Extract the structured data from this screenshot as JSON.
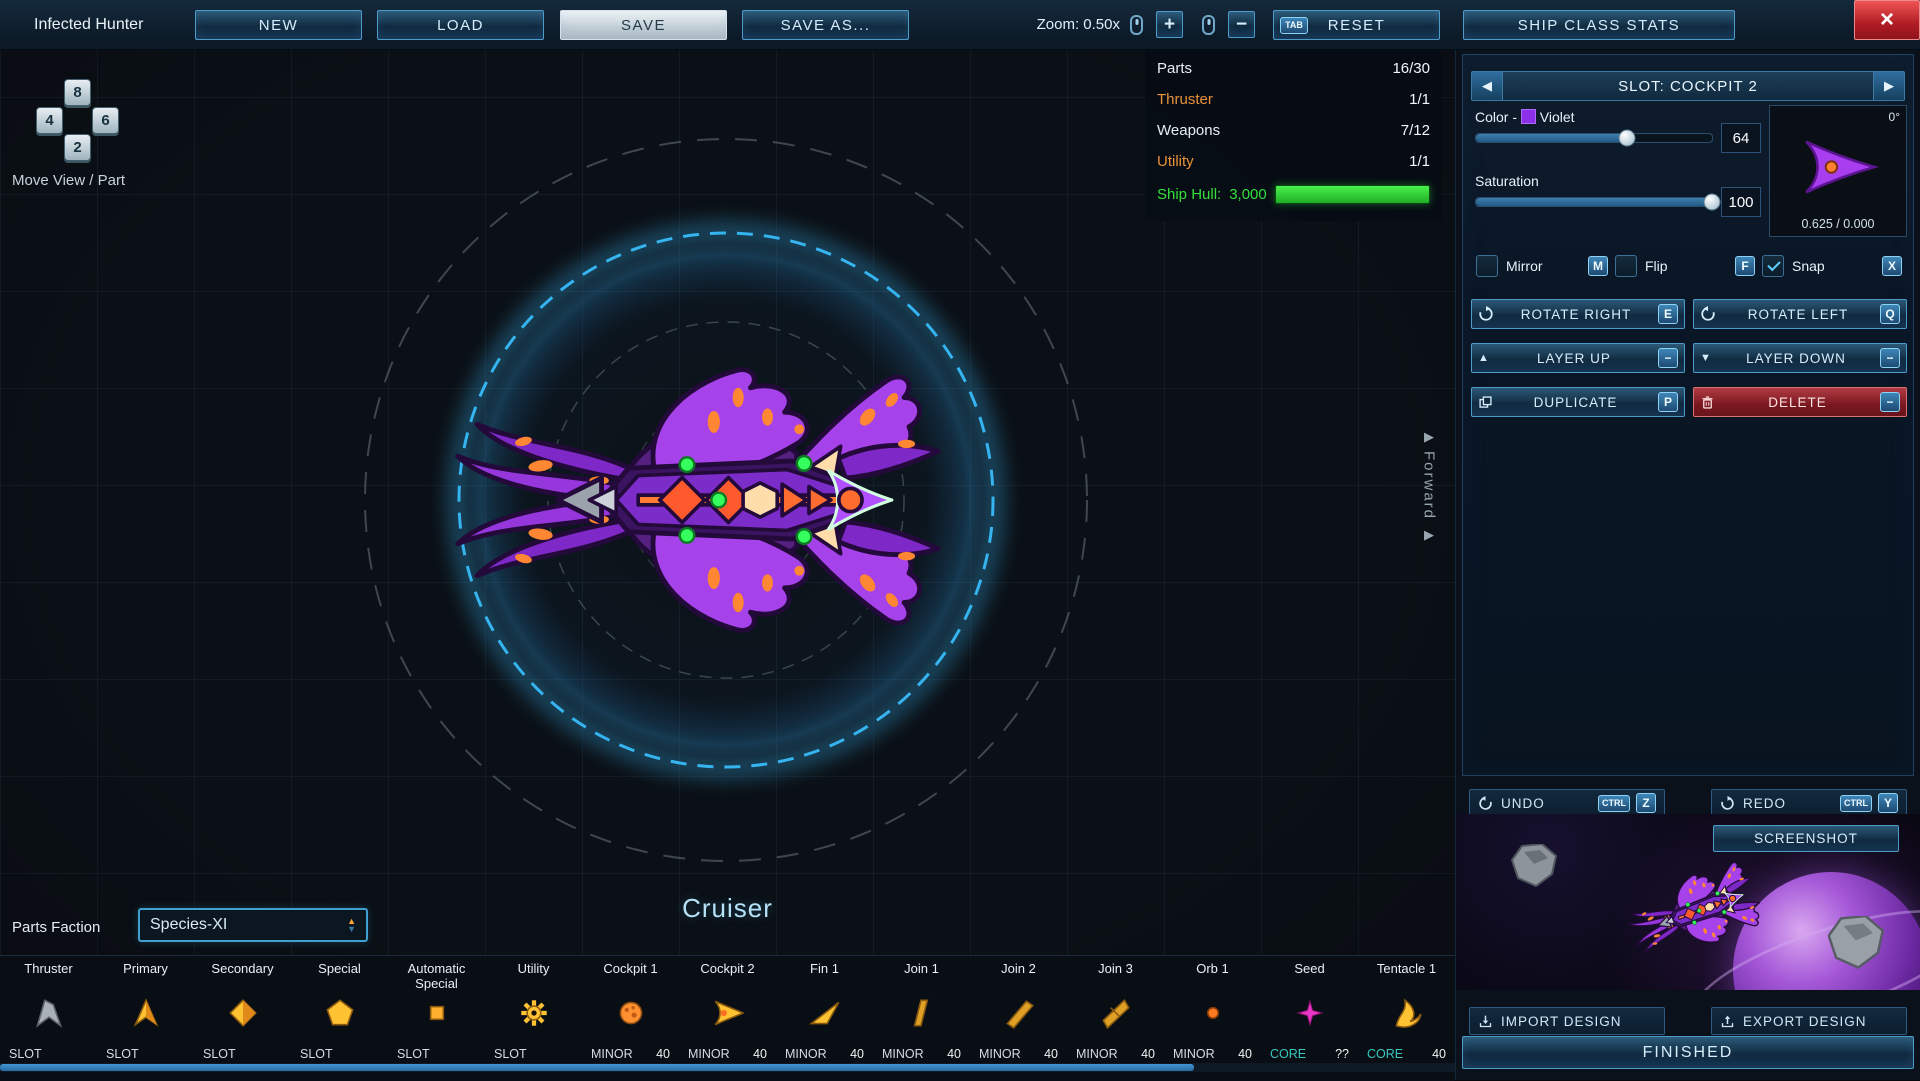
{
  "colors": {
    "accent_blue": "#4fb7e8",
    "violet": "#a044ec",
    "hull_green": "#2ee62e",
    "warning_orange": "#e8923a",
    "delete_red": "#9b2430"
  },
  "top_bar": {
    "ship_name": "Infected Hunter",
    "new_label": "NEW",
    "load_label": "LOAD",
    "save_label": "SAVE",
    "save_as_label": "SAVE AS...",
    "zoom_label": "Zoom: 0.50x",
    "zoom_in_label": "+",
    "zoom_out_label": "−",
    "reset_label": "RESET",
    "reset_key": "TAB",
    "ship_class_stats_label": "SHIP CLASS STATS",
    "close_label": "×"
  },
  "move_pad": {
    "up_key": "8",
    "left_key": "4",
    "right_key": "6",
    "down_key": "2",
    "caption": "Move View / Part"
  },
  "build_stats": {
    "rows": [
      {
        "label": "Parts",
        "value": "16/30",
        "alert": false
      },
      {
        "label": "Thruster",
        "value": "1/1",
        "alert": true
      },
      {
        "label": "Weapons",
        "value": "7/12",
        "alert": false
      },
      {
        "label": "Utility",
        "value": "1/1",
        "alert": true
      }
    ],
    "hull_label": "Ship Hull:",
    "hull_value": "3,000"
  },
  "canvas": {
    "ship_class": "Cruiser",
    "forward_label": "Forward"
  },
  "slot_panel": {
    "title": "SLOT: COCKPIT 2",
    "color_label": "Color -",
    "color_name": "Violet",
    "color_value": "64",
    "saturation_label": "Saturation",
    "saturation_value": "100",
    "preview_angle": "0°",
    "preview_offset": "0.625 / 0.000",
    "mirror_label": "Mirror",
    "mirror_key": "M",
    "mirror_checked": false,
    "flip_label": "Flip",
    "flip_key": "F",
    "flip_checked": false,
    "snap_label": "Snap",
    "snap_key": "X",
    "snap_checked": true,
    "rotate_right_label": "ROTATE RIGHT",
    "rotate_right_key": "E",
    "rotate_left_label": "ROTATE LEFT",
    "rotate_left_key": "Q",
    "layer_up_label": "LAYER UP",
    "layer_up_key": "−",
    "layer_down_label": "LAYER DOWN",
    "layer_down_key": "−",
    "duplicate_label": "DUPLICATE",
    "duplicate_key": "P",
    "delete_label": "DELETE",
    "delete_key": "−"
  },
  "history": {
    "undo_label": "UNDO",
    "undo_key_1": "CTRL",
    "undo_key_2": "Z",
    "redo_label": "REDO",
    "redo_key_1": "CTRL",
    "redo_key_2": "Y"
  },
  "output_panel": {
    "screenshot_label": "SCREENSHOT",
    "import_label": "IMPORT DESIGN",
    "export_label": "EXPORT DESIGN",
    "finished_label": "FINISHED"
  },
  "parts_bar": {
    "faction_label": "Parts Faction",
    "faction_value": "Species-XI",
    "items": [
      {
        "name": "Thruster",
        "tag": "SLOT",
        "cost": "",
        "icon": "thruster-icon"
      },
      {
        "name": "Primary",
        "tag": "SLOT",
        "cost": "",
        "icon": "primary-weapon-icon"
      },
      {
        "name": "Secondary",
        "tag": "SLOT",
        "cost": "",
        "icon": "secondary-weapon-icon"
      },
      {
        "name": "Special",
        "tag": "SLOT",
        "cost": "",
        "icon": "special-weapon-icon"
      },
      {
        "name": "Automatic Special",
        "tag": "SLOT",
        "cost": "",
        "icon": "automatic-special-icon"
      },
      {
        "name": "Utility",
        "tag": "SLOT",
        "cost": "",
        "icon": "utility-icon"
      },
      {
        "name": "Cockpit 1",
        "tag": "MINOR",
        "cost": "40",
        "icon": "cockpit-1-icon"
      },
      {
        "name": "Cockpit 2",
        "tag": "MINOR",
        "cost": "40",
        "icon": "cockpit-2-icon"
      },
      {
        "name": "Fin 1",
        "tag": "MINOR",
        "cost": "40",
        "icon": "fin-1-icon"
      },
      {
        "name": "Join 1",
        "tag": "MINOR",
        "cost": "40",
        "icon": "join-1-icon"
      },
      {
        "name": "Join 2",
        "tag": "MINOR",
        "cost": "40",
        "icon": "join-2-icon"
      },
      {
        "name": "Join 3",
        "tag": "MINOR",
        "cost": "40",
        "icon": "join-3-icon"
      },
      {
        "name": "Orb 1",
        "tag": "MINOR",
        "cost": "40",
        "icon": "orb-1-icon"
      },
      {
        "name": "Seed",
        "tag": "CORE",
        "cost": "??",
        "icon": "seed-icon"
      },
      {
        "name": "Tentacle 1",
        "tag": "CORE",
        "cost": "40",
        "icon": "tentacle-1-icon"
      }
    ]
  }
}
